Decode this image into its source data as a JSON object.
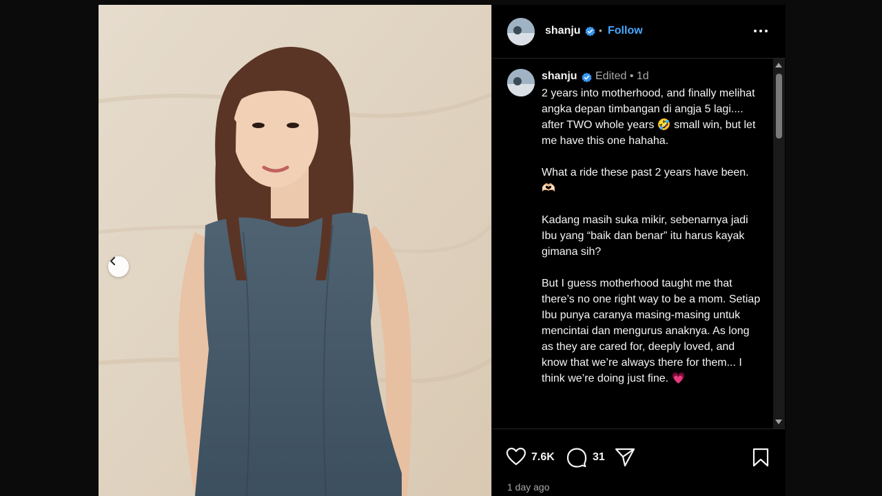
{
  "post": {
    "author": "shanju",
    "follow_label": "Follow",
    "separator": "•",
    "caption": {
      "author": "shanju",
      "meta": "Edited •  1d",
      "text": "2 years into motherhood, and finally melihat angka depan timbangan di angja 5 lagi.... after TWO whole years 🤣 small win, but let me have this one hahaha.\n\nWhat a ride these past 2 years have been.🫶🏻\n\nKadang masih suka mikir, sebenarnya jadi Ibu yang “baik dan benar” itu harus kayak gimana sih?\n\nBut I guess motherhood taught me that there’s no one right way to be a mom. Setiap Ibu punya caranya masing-masing untuk mencintai dan mengurus anaknya. As long as they are cared for, deeply loved, and know that we’re always there for them... I think we’re doing just fine. 💗"
    },
    "likes": "7.6K",
    "comments": "31",
    "time_ago": "1 day ago"
  },
  "icons": {
    "verified": "verified-badge-icon",
    "more": "more-options-icon",
    "like": "heart-icon",
    "comment": "comment-icon",
    "share": "share-icon",
    "save": "bookmark-icon",
    "prev": "chevron-left-icon"
  },
  "colors": {
    "accent": "#4aa8ff",
    "verified": "#3897f0",
    "background": "#000000",
    "muted_text": "#a8a8a8"
  }
}
